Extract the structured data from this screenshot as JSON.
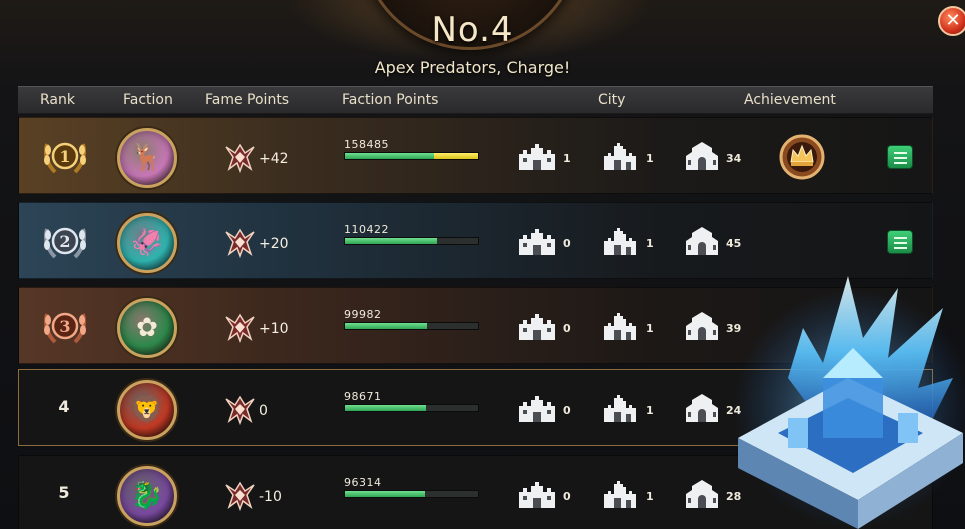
{
  "title": "No.4",
  "subtitle": "Apex Predators, Charge!",
  "close_icon": "close-icon",
  "headers": {
    "rank": "Rank",
    "faction": "Faction",
    "fame": "Fame Points",
    "faction_points": "Faction Points",
    "city": "City",
    "achievement": "Achievement"
  },
  "colors": {
    "bar_green": "#3fbf64",
    "bar_gold": "#e9d52a",
    "button_green": "#2aa85b",
    "rank4_border": "#8c6b3c"
  },
  "rows": [
    {
      "rank": "1",
      "rank_style": "gold-laurel-badge",
      "faction_icon": "stag-sigil-icon",
      "faction_color": "#c978b8",
      "fame": "+42",
      "faction_points": "158485",
      "fp_green_fraction": 0.67,
      "fp_gold_fraction": 0.33,
      "city_counts": [
        "1",
        "1",
        "34"
      ],
      "achievement_icon": "crown-achievement-icon",
      "has_detail": true
    },
    {
      "rank": "2",
      "rank_style": "silver-laurel-badge",
      "faction_icon": "kraken-sigil-icon",
      "faction_color": "#2fb5b0",
      "fame": "+20",
      "faction_points": "110422",
      "fp_green_fraction": 0.69,
      "fp_gold_fraction": 0,
      "city_counts": [
        "0",
        "1",
        "45"
      ],
      "achievement_icon": "",
      "has_detail": true
    },
    {
      "rank": "3",
      "rank_style": "bronze-laurel-badge",
      "faction_icon": "rose-sigil-icon",
      "faction_color": "#2e8a4c",
      "fame": "+10",
      "faction_points": "99982",
      "fp_green_fraction": 0.62,
      "fp_gold_fraction": 0,
      "city_counts": [
        "0",
        "1",
        "39"
      ],
      "achievement_icon": "",
      "has_detail": false
    },
    {
      "rank": "4",
      "rank_style": "plain",
      "faction_icon": "lion-sigil-icon",
      "faction_color": "#c23a24",
      "fame": "0",
      "faction_points": "98671",
      "fp_green_fraction": 0.61,
      "fp_gold_fraction": 0,
      "city_counts": [
        "0",
        "1",
        "24"
      ],
      "achievement_icon": "",
      "has_detail": false
    },
    {
      "rank": "5",
      "rank_style": "plain",
      "faction_icon": "dragon-sigil-icon",
      "faction_color": "#7a4aa0",
      "fame": "-10",
      "faction_points": "96314",
      "fp_green_fraction": 0.6,
      "fp_gold_fraction": 0,
      "city_counts": [
        "0",
        "1",
        "28"
      ],
      "achievement_icon": "",
      "has_detail": false
    }
  ],
  "city_icons": [
    "fortress-city-icon",
    "castle-city-icon",
    "temple-city-icon"
  ],
  "decoration": "ice-fortress-illustration"
}
